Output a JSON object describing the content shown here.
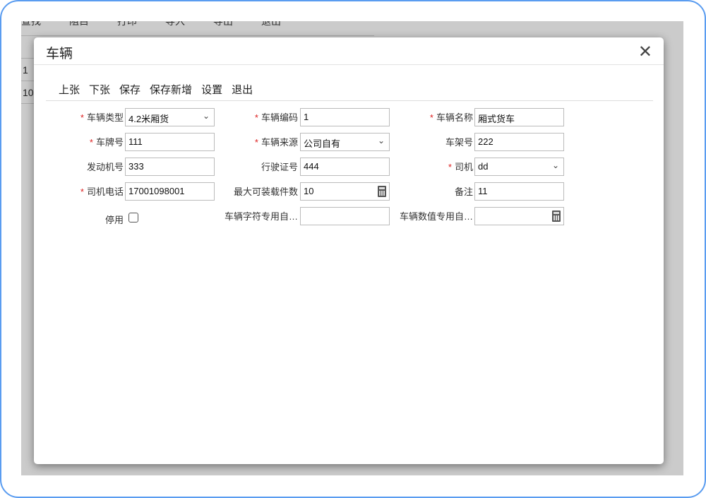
{
  "background": {
    "toolbar": [
      "查找",
      "阻目",
      "打印",
      "导入",
      "导出",
      "退出"
    ],
    "rows": [
      "1",
      "10"
    ]
  },
  "dialog": {
    "title": "车辆",
    "close_icon": "close-icon",
    "toolbar": [
      "上张",
      "下张",
      "保存",
      "保存新增",
      "设置",
      "退出"
    ],
    "fields": [
      {
        "label": "车辆类型",
        "required": true,
        "value": "4.2米厢货",
        "type": "select"
      },
      {
        "label": "车辆编码",
        "required": true,
        "value": "1",
        "type": "text"
      },
      {
        "label": "车辆名称",
        "required": true,
        "value": "厢式货车",
        "type": "text"
      },
      {
        "label": "车牌号",
        "required": true,
        "value": "111",
        "type": "text"
      },
      {
        "label": "车辆来源",
        "required": true,
        "value": "公司自有",
        "type": "select"
      },
      {
        "label": "车架号",
        "required": false,
        "value": "222",
        "type": "text"
      },
      {
        "label": "发动机号",
        "required": false,
        "value": "333",
        "type": "text"
      },
      {
        "label": "行驶证号",
        "required": false,
        "value": "444",
        "type": "text"
      },
      {
        "label": "司机",
        "required": true,
        "value": "dd",
        "type": "select"
      },
      {
        "label": "司机电话",
        "required": true,
        "value": "17001098001",
        "type": "text"
      },
      {
        "label": "最大可装载件数",
        "required": false,
        "value": "10",
        "type": "number"
      },
      {
        "label": "备注",
        "required": false,
        "value": "11",
        "type": "text"
      },
      {
        "label": "停用",
        "required": false,
        "value": "",
        "type": "checkbox",
        "checked": false
      },
      {
        "label": "车辆字符专用自…",
        "required": false,
        "value": "",
        "type": "text"
      },
      {
        "label": "车辆数值专用自…",
        "required": false,
        "value": "",
        "type": "number"
      }
    ]
  }
}
